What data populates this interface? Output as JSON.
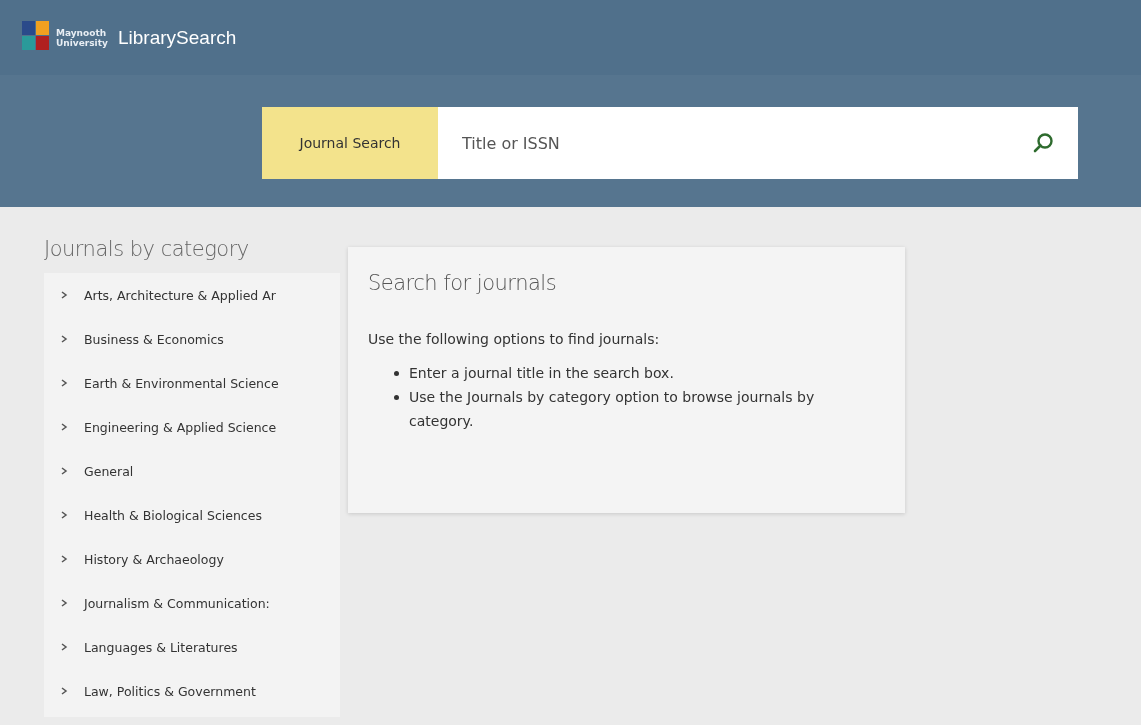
{
  "header": {
    "logo_text": "Maynooth University",
    "brand": "LibrarySearch"
  },
  "search": {
    "scope": "Journal Search",
    "placeholder": "Title or ISSN"
  },
  "sidebar": {
    "title": "Journals by category",
    "items": [
      {
        "label": "Arts, Architecture & Applied Ar"
      },
      {
        "label": "Business & Economics"
      },
      {
        "label": "Earth & Environmental Science"
      },
      {
        "label": "Engineering & Applied Science"
      },
      {
        "label": "General"
      },
      {
        "label": "Health & Biological Sciences"
      },
      {
        "label": "History & Archaeology"
      },
      {
        "label": "Journalism & Communication:"
      },
      {
        "label": "Languages & Literatures"
      },
      {
        "label": "Law, Politics & Government"
      }
    ]
  },
  "card": {
    "title": "Search for journals",
    "intro": "Use the following options to find journals:",
    "bullets": [
      "Enter a journal title in the search box.",
      "Use the Journals by category option to browse journals by category."
    ]
  }
}
